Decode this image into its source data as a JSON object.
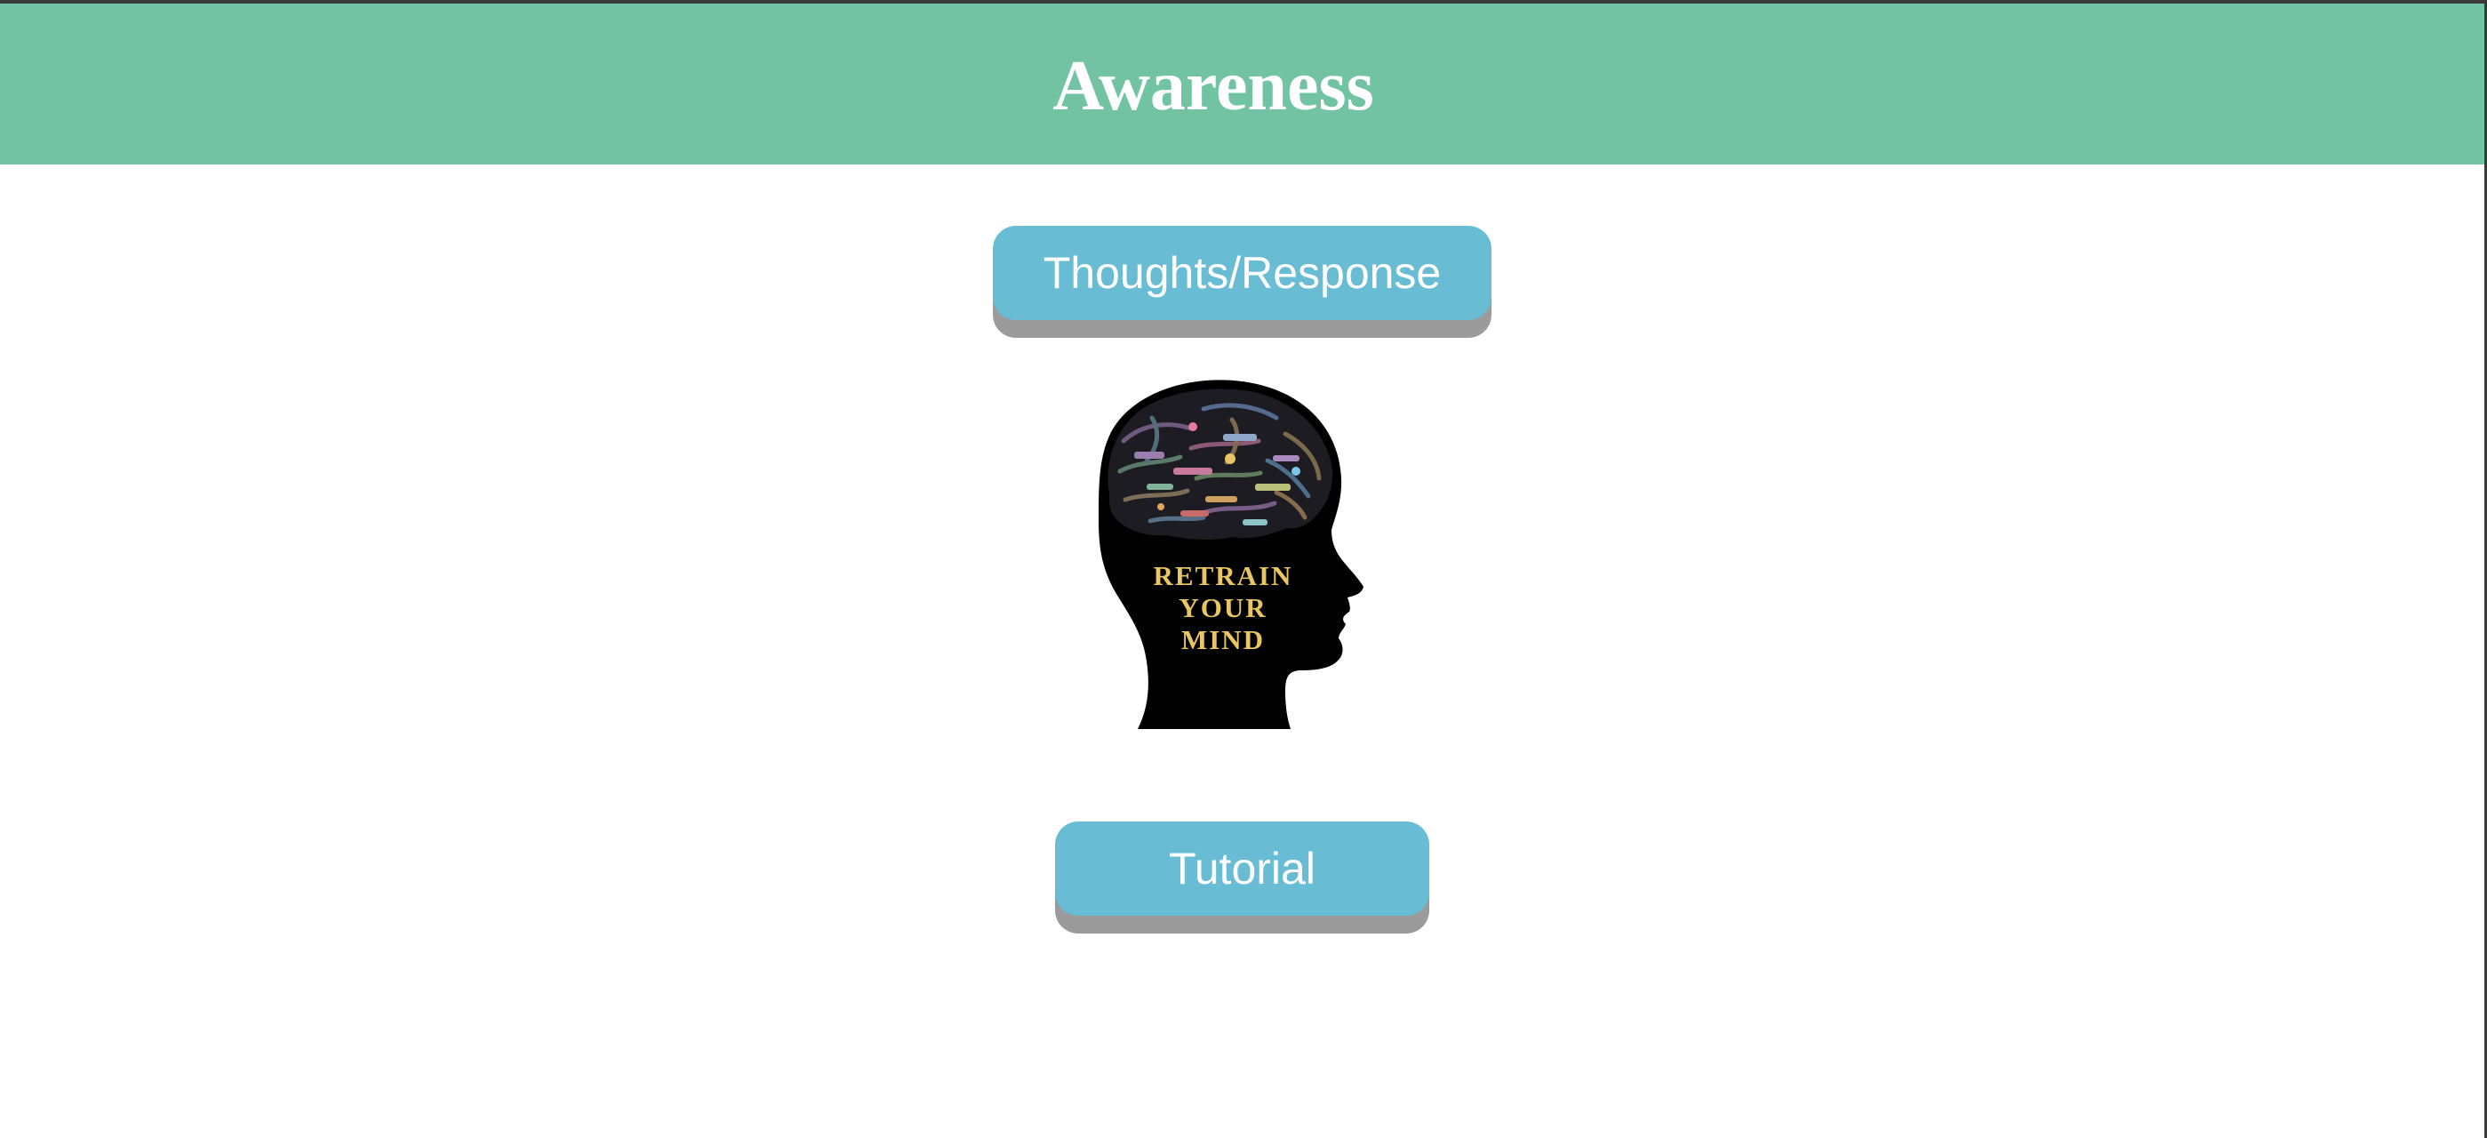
{
  "header": {
    "title": "Awareness",
    "background_color": "#72c3a3"
  },
  "buttons": {
    "thoughts_label": "Thoughts/Response",
    "tutorial_label": "Tutorial",
    "color": "#68bcd3"
  },
  "illustration": {
    "icon": "head-silhouette-brain-icon",
    "lines": [
      "RETRAIN",
      "YOUR",
      "MIND"
    ],
    "text_color": "#e8c565"
  }
}
